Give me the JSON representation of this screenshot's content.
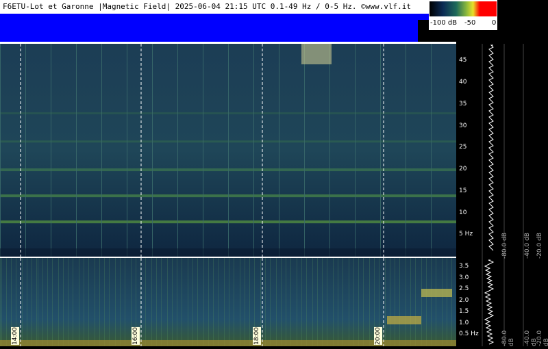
{
  "header": {
    "title": "F6ETU-Lot et Garonne |Magnetic Field| 2025-06-04 21:15 UTC 0.1-49 Hz / 0-5 Hz. ©www.vlf.it"
  },
  "scale": {
    "labels": [
      "-100 dB",
      "-50",
      "0"
    ],
    "colors": [
      "#000000",
      "#0b2b55",
      "#1f6a5a",
      "#8ab83c",
      "#e8e02a",
      "#ff0000"
    ]
  },
  "top_axis": {
    "labels": [
      "45",
      "40",
      "35",
      "30",
      "25",
      "20",
      "15",
      "10",
      "5 Hz"
    ],
    "values": [
      45,
      40,
      35,
      30,
      25,
      20,
      15,
      10,
      5
    ],
    "min": 0,
    "max": 49
  },
  "bottom_axis": {
    "labels": [
      "3.5",
      "3.0",
      "2.5",
      "2.0",
      "1.5",
      "1.0",
      "0.5 Hz"
    ],
    "values": [
      3.5,
      3.0,
      2.5,
      2.0,
      1.5,
      1.0,
      0.5
    ],
    "min": 0,
    "max": 3.9
  },
  "time_labels": [
    "14:00",
    "16:00",
    "18:00",
    "20:00"
  ],
  "db_labels_top": [
    "-80.0 dB",
    "-40.0 dB",
    "-20.0 dB"
  ],
  "db_labels_bottom": [
    "-80.0 dB",
    "-40.0 dB",
    "-20.0 dB"
  ]
}
